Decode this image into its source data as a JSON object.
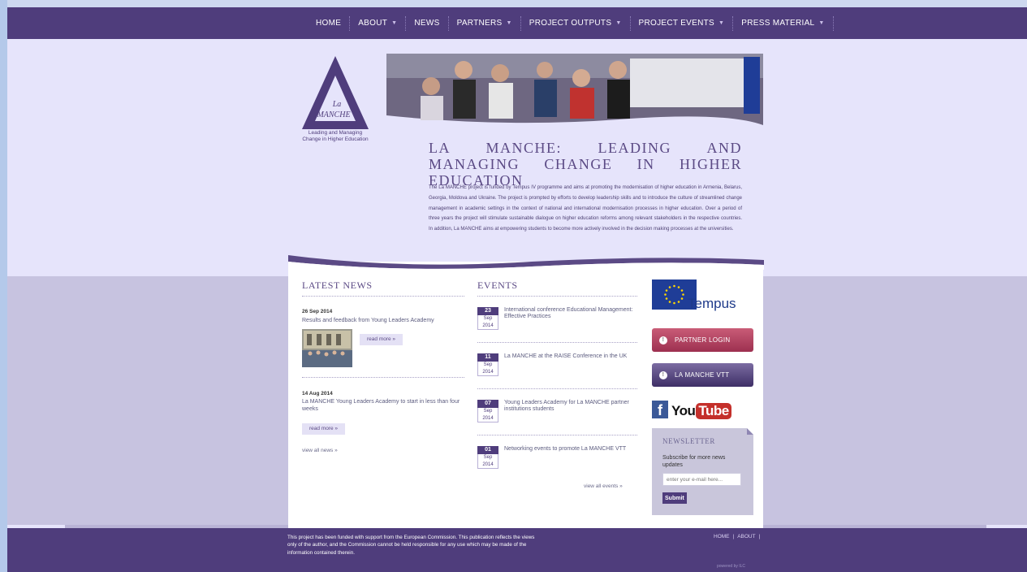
{
  "nav": {
    "items": [
      {
        "label": "Home",
        "caret": false
      },
      {
        "label": "About",
        "caret": true
      },
      {
        "label": "News",
        "caret": false
      },
      {
        "label": "Partners",
        "caret": true
      },
      {
        "label": "Project Outputs",
        "caret": true
      },
      {
        "label": "Project Events",
        "caret": true
      },
      {
        "label": "Press Material",
        "caret": true
      }
    ]
  },
  "logo": {
    "mark_text_line1": "La",
    "mark_text_line2": "MANCHE",
    "caption": "Leading and Managing Change in Higher Education"
  },
  "hero": {
    "title": "La MANCHE: Leading and Managing Change in Higher Education",
    "intro": "The La MANCHE project is funded by Tempus IV programme and aims at promoting the modernisation of higher education in Armenia, Belarus, Georgia, Moldova and Ukraine. The project is prompted by efforts to develop leadership skills and to introduce the culture of streamlined change management in academic settings in the context of national and international modernisation processes in higher education. Over a period of three years the project will stimulate sustainable dialogue on higher education reforms among relevant stakeholders in the respective countries. In addition, La MANCHE aims at empowering students to become more actively involved in the decision making processes at the universities."
  },
  "news": {
    "title": "Latest News",
    "items": [
      {
        "date": "26 Sep 2014",
        "title": "Results and feedback from Young Leaders Academy",
        "read_more": "read more »"
      },
      {
        "date": "14 Aug 2014",
        "title": "La MANCHE Young Leaders Academy to start in less than four weeks",
        "read_more": "read more »"
      }
    ],
    "view_all": "view all news »"
  },
  "events": {
    "title": "Events",
    "items": [
      {
        "day": "23",
        "month": "Sep",
        "year": "2014",
        "title": "International conference Educational Management: Effective Practices"
      },
      {
        "day": "11",
        "month": "Sep",
        "year": "2014",
        "title": "La MANCHE at the RAISE Conference in the UK"
      },
      {
        "day": "07",
        "month": "Sep",
        "year": "2014",
        "title": "Young Leaders Academy for La MANCHE partner institutions students"
      },
      {
        "day": "01",
        "month": "Sep",
        "year": "2014",
        "title": "Networking events to promote La MANCHE VTT"
      }
    ],
    "view_all": "view all events »"
  },
  "sidebar": {
    "tempus_label": "Tempus",
    "partner_login": "Partner Login",
    "vtt": "La MANCHE VTT",
    "facebook_letter": "f",
    "youtube_you": "You",
    "youtube_tube": "Tube"
  },
  "newsletter": {
    "title": "Newsletter",
    "text": "Subscribe for more news updates",
    "placeholder": "enter your e-mail here...",
    "submit": "Submit"
  },
  "footer": {
    "disclaimer": "This project has been funded with support from the European Commission. This publication reflects the views only of the author, and the Commission cannot be held responsible for any use which may be made of the information contained therein.",
    "links": [
      "HOME",
      "ABOUT"
    ],
    "powered": "powered by ILC"
  },
  "colors": {
    "brand_purple": "#4f3d7c",
    "page_background": "#e6e4fb",
    "login_button": "#b0405f"
  }
}
